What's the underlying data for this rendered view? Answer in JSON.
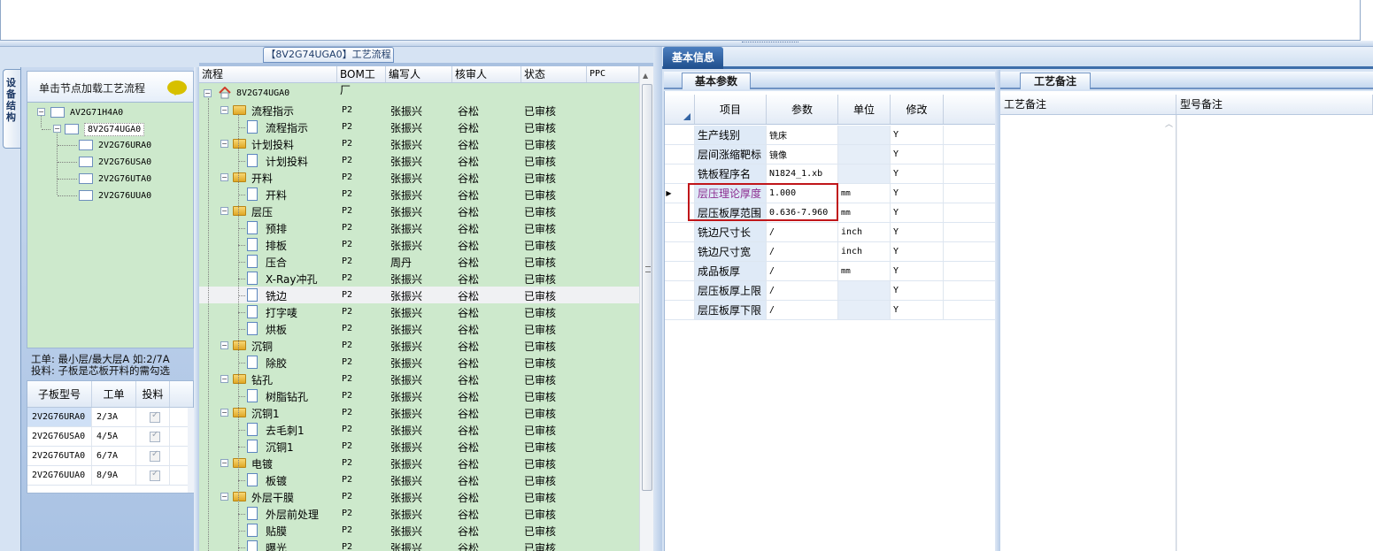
{
  "left_panel": {
    "vertical_tab_label": "设备结构",
    "tree_header": "单击节点加载工艺流程",
    "tree": [
      {
        "label": "AV2G71H4A0",
        "level": 0
      },
      {
        "label": "8V2G74UGA0",
        "level": 1,
        "selected": true
      },
      {
        "label": "2V2G76URA0",
        "level": 2
      },
      {
        "label": "2V2G76USA0",
        "level": 2
      },
      {
        "label": "2V2G76UTA0",
        "level": 2
      },
      {
        "label": "2V2G76UUA0",
        "level": 2
      }
    ],
    "note_line1": "工单: 最小层/最大层A 如:2/7A",
    "note_line2": "投料: 子板是芯板开料的需勾选",
    "sub_table": {
      "headers": [
        "子板型号",
        "工单",
        "投料"
      ],
      "rows": [
        {
          "model": "2V2G76URA0",
          "order": "2/3A",
          "feed": true
        },
        {
          "model": "2V2G76USA0",
          "order": "4/5A",
          "feed": true
        },
        {
          "model": "2V2G76UTA0",
          "order": "6/7A",
          "feed": true
        },
        {
          "model": "2V2G76UUA0",
          "order": "8/9A",
          "feed": true
        }
      ]
    }
  },
  "process": {
    "title": "【8V2G74UGA0】工艺流程",
    "headers": {
      "flow": "流程",
      "bom": "BOM工厂",
      "writer": "编写人",
      "reviewer": "核审人",
      "status": "状态",
      "ppc": "PPC"
    },
    "root": "8V2G74UGA0",
    "rows": [
      {
        "name": "流程指示",
        "type": "folder",
        "bom": "P2",
        "writer": "张振兴",
        "reviewer": "谷松",
        "status": "已审核"
      },
      {
        "name": "流程指示",
        "type": "doc",
        "bom": "P2",
        "writer": "张振兴",
        "reviewer": "谷松",
        "status": "已审核"
      },
      {
        "name": "计划投料",
        "type": "folder",
        "bom": "P2",
        "writer": "张振兴",
        "reviewer": "谷松",
        "status": "已审核"
      },
      {
        "name": "计划投料",
        "type": "doc",
        "bom": "P2",
        "writer": "张振兴",
        "reviewer": "谷松",
        "status": "已审核"
      },
      {
        "name": "开料",
        "type": "folder",
        "bom": "P2",
        "writer": "张振兴",
        "reviewer": "谷松",
        "status": "已审核"
      },
      {
        "name": "开料",
        "type": "doc",
        "bom": "P2",
        "writer": "张振兴",
        "reviewer": "谷松",
        "status": "已审核"
      },
      {
        "name": "层压",
        "type": "folder",
        "bom": "P2",
        "writer": "张振兴",
        "reviewer": "谷松",
        "status": "已审核"
      },
      {
        "name": "预排",
        "type": "doc",
        "bom": "P2",
        "writer": "张振兴",
        "reviewer": "谷松",
        "status": "已审核"
      },
      {
        "name": "排板",
        "type": "doc",
        "bom": "P2",
        "writer": "张振兴",
        "reviewer": "谷松",
        "status": "已审核"
      },
      {
        "name": "压合",
        "type": "doc",
        "bom": "P2",
        "writer": "周丹",
        "reviewer": "谷松",
        "status": "已审核"
      },
      {
        "name": "X-Ray冲孔",
        "type": "doc",
        "bom": "P2",
        "writer": "张振兴",
        "reviewer": "谷松",
        "status": "已审核"
      },
      {
        "name": "铣边",
        "type": "doc",
        "bom": "P2",
        "writer": "张振兴",
        "reviewer": "谷松",
        "status": "已审核",
        "highlight": true
      },
      {
        "name": "打字唛",
        "type": "doc",
        "bom": "P2",
        "writer": "张振兴",
        "reviewer": "谷松",
        "status": "已审核"
      },
      {
        "name": "烘板",
        "type": "doc",
        "bom": "P2",
        "writer": "张振兴",
        "reviewer": "谷松",
        "status": "已审核"
      },
      {
        "name": "沉铜",
        "type": "folder",
        "bom": "P2",
        "writer": "张振兴",
        "reviewer": "谷松",
        "status": "已审核"
      },
      {
        "name": "除胶",
        "type": "doc",
        "bom": "P2",
        "writer": "张振兴",
        "reviewer": "谷松",
        "status": "已审核"
      },
      {
        "name": "钻孔",
        "type": "folder",
        "bom": "P2",
        "writer": "张振兴",
        "reviewer": "谷松",
        "status": "已审核"
      },
      {
        "name": "树脂钻孔",
        "type": "doc",
        "bom": "P2",
        "writer": "张振兴",
        "reviewer": "谷松",
        "status": "已审核"
      },
      {
        "name": "沉铜1",
        "type": "folder",
        "bom": "P2",
        "writer": "张振兴",
        "reviewer": "谷松",
        "status": "已审核"
      },
      {
        "name": "去毛刺1",
        "type": "doc",
        "bom": "P2",
        "writer": "张振兴",
        "reviewer": "谷松",
        "status": "已审核"
      },
      {
        "name": "沉铜1",
        "type": "doc",
        "bom": "P2",
        "writer": "张振兴",
        "reviewer": "谷松",
        "status": "已审核"
      },
      {
        "name": "电镀",
        "type": "folder",
        "bom": "P2",
        "writer": "张振兴",
        "reviewer": "谷松",
        "status": "已审核"
      },
      {
        "name": "板镀",
        "type": "doc",
        "bom": "P2",
        "writer": "张振兴",
        "reviewer": "谷松",
        "status": "已审核"
      },
      {
        "name": "外层干膜",
        "type": "folder",
        "bom": "P2",
        "writer": "张振兴",
        "reviewer": "谷松",
        "status": "已审核"
      },
      {
        "name": "外层前处理",
        "type": "doc",
        "bom": "P2",
        "writer": "张振兴",
        "reviewer": "谷松",
        "status": "已审核"
      },
      {
        "name": "贴膜",
        "type": "doc",
        "bom": "P2",
        "writer": "张振兴",
        "reviewer": "谷松",
        "status": "已审核"
      },
      {
        "name": "曝光",
        "type": "doc",
        "bom": "P2",
        "writer": "张振兴",
        "reviewer": "谷松",
        "status": "已审核"
      }
    ]
  },
  "right_panel": {
    "main_tab": "基本信息",
    "params_tab": "基本参数",
    "params_headers": {
      "item": "项目",
      "param": "参数",
      "unit": "单位",
      "modify": "修改"
    },
    "params_rows": [
      {
        "item": "生产线别",
        "param": "铣床",
        "unit": "",
        "modify": "Y"
      },
      {
        "item": "层间涨缩靶标",
        "param": "镜像",
        "unit": "",
        "modify": "Y"
      },
      {
        "item": "铣板程序名",
        "param": "N1824_1.xb",
        "unit": "",
        "modify": "Y"
      },
      {
        "item": "层压理论厚度",
        "param": "1.000",
        "unit": "mm",
        "modify": "Y",
        "current": true
      },
      {
        "item": "层压板厚范围",
        "param": "0.636-7.960",
        "unit": "mm",
        "modify": "Y"
      },
      {
        "item": "铣边尺寸长",
        "param": "/",
        "unit": "inch",
        "modify": "Y"
      },
      {
        "item": "铣边尺寸宽",
        "param": "/",
        "unit": "inch",
        "modify": "Y"
      },
      {
        "item": "成品板厚",
        "param": "/",
        "unit": "mm",
        "modify": "Y"
      },
      {
        "item": "层压板厚上限",
        "param": "/",
        "unit": "",
        "modify": "Y"
      },
      {
        "item": "层压板厚下限",
        "param": "/",
        "unit": "",
        "modify": "Y"
      }
    ],
    "craft_tab": "工艺备注",
    "craft_headers": {
      "craft_note": "工艺备注",
      "model_note": "型号备注"
    }
  },
  "colors": {
    "tree_green": "#cde9cc",
    "tab_blue": "#1f4e8c",
    "highlight_box": "#c0161a",
    "purple_text": "#8b2b8f"
  }
}
